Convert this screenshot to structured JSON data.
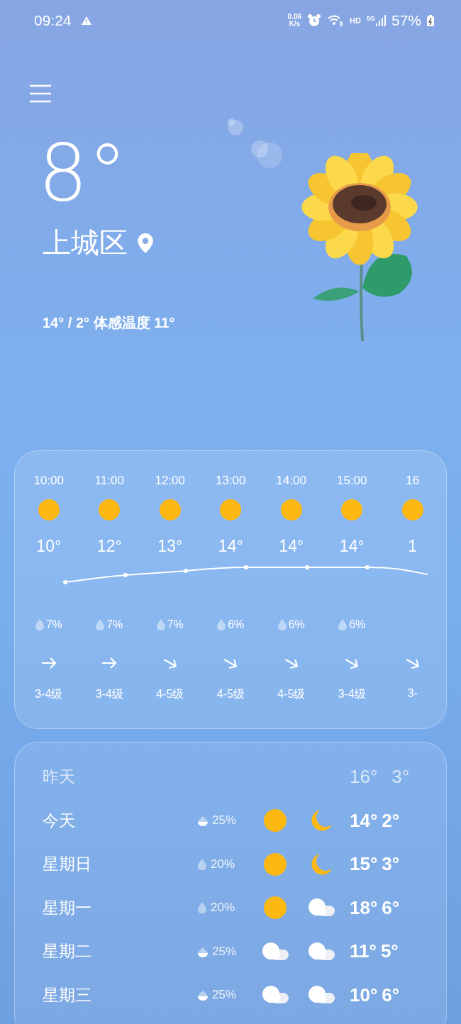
{
  "status_bar": {
    "time": "09:24",
    "speed_value": "0.06",
    "speed_unit": "K/s",
    "network": "HD",
    "cellular": "5G",
    "battery": "57%"
  },
  "current": {
    "temperature": "8°",
    "location": "上城区",
    "summary": "14° / 2° 体感温度 11°"
  },
  "hourly": [
    {
      "time": "10:00",
      "icon": {
        "kind": "sun"
      },
      "temp": "10°",
      "rain": "7%",
      "wind_arrow": {
        "kind": "east"
      },
      "wind": "3-4级"
    },
    {
      "time": "11:00",
      "icon": {
        "kind": "sun"
      },
      "temp": "12°",
      "rain": "7%",
      "wind_arrow": {
        "kind": "east"
      },
      "wind": "3-4级"
    },
    {
      "time": "12:00",
      "icon": {
        "kind": "sun"
      },
      "temp": "13°",
      "rain": "7%",
      "wind_arrow": {
        "kind": "southeast"
      },
      "wind": "4-5级"
    },
    {
      "time": "13:00",
      "icon": {
        "kind": "sun"
      },
      "temp": "14°",
      "rain": "6%",
      "wind_arrow": {
        "kind": "southeast"
      },
      "wind": "4-5级"
    },
    {
      "time": "14:00",
      "icon": {
        "kind": "sun"
      },
      "temp": "14°",
      "rain": "6%",
      "wind_arrow": {
        "kind": "southeast"
      },
      "wind": "4-5级"
    },
    {
      "time": "15:00",
      "icon": {
        "kind": "sun"
      },
      "temp": "14°",
      "rain": "6%",
      "wind_arrow": {
        "kind": "southeast"
      },
      "wind": "3-4级"
    },
    {
      "time": "16",
      "icon": {
        "kind": "sun"
      },
      "temp": "1",
      "wind_arrow": {
        "kind": "southeast"
      },
      "wind": "3-"
    }
  ],
  "daily": [
    {
      "kind": "past",
      "day": "昨天",
      "high": "16°",
      "low": "3°"
    },
    {
      "kind": "forecast",
      "day": "今天",
      "rain_icon": {
        "kind": "half"
      },
      "rain": "25%",
      "day_icon": {
        "kind": "sun"
      },
      "night_icon": {
        "kind": "moon"
      },
      "high": "14°",
      "low": "2°"
    },
    {
      "kind": "forecast",
      "day": "星期日",
      "rain_icon": {
        "kind": "full"
      },
      "rain": "20%",
      "day_icon": {
        "kind": "sun"
      },
      "night_icon": {
        "kind": "moon"
      },
      "high": "15°",
      "low": "3°"
    },
    {
      "kind": "forecast",
      "day": "星期一",
      "rain_icon": {
        "kind": "full"
      },
      "rain": "20%",
      "day_icon": {
        "kind": "sun"
      },
      "night_icon": {
        "kind": "cloud"
      },
      "high": "18°",
      "low": "6°"
    },
    {
      "kind": "forecast",
      "day": "星期二",
      "rain_icon": {
        "kind": "half"
      },
      "rain": "25%",
      "day_icon": {
        "kind": "cloud"
      },
      "night_icon": {
        "kind": "cloud"
      },
      "high": "11°",
      "low": "5°"
    },
    {
      "kind": "forecast",
      "day": "星期三",
      "rain_icon": {
        "kind": "half"
      },
      "rain": "25%",
      "day_icon": {
        "kind": "cloud"
      },
      "night_icon": {
        "kind": "cloud"
      },
      "high": "10°",
      "low": "6°"
    }
  ]
}
